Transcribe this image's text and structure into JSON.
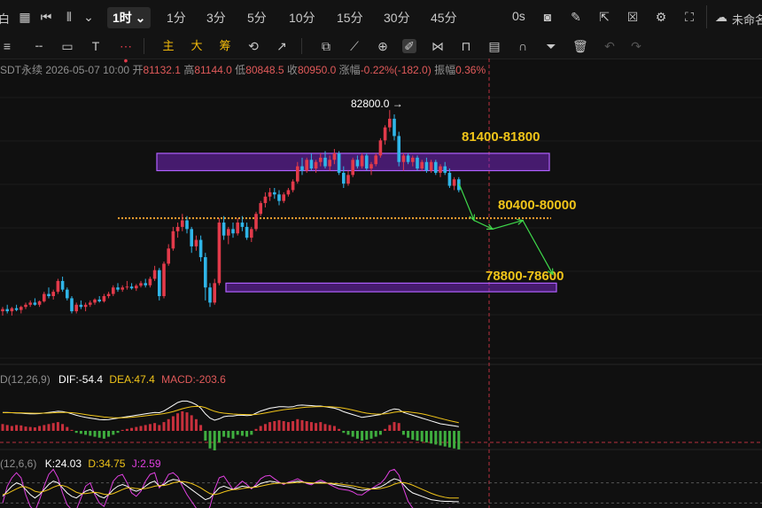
{
  "toolbar": {
    "left_label": "白",
    "intervals": [
      {
        "label": "1时",
        "active": true
      },
      {
        "label": "1分"
      },
      {
        "label": "3分"
      },
      {
        "label": "5分"
      },
      {
        "label": "10分"
      },
      {
        "label": "15分"
      },
      {
        "label": "30分"
      },
      {
        "label": "45分"
      }
    ],
    "zero_label": "0s",
    "right_label": "未命名"
  },
  "drawbar": {
    "cn_tools": [
      "主",
      "大",
      "筹"
    ]
  },
  "info": {
    "symbol": "SDT永续",
    "datetime": "2026-05-07 10:00",
    "open_label": "开",
    "open": "81132.1",
    "high_label": "高",
    "high": "81144.0",
    "low_label": "低",
    "low": "80848.5",
    "close_label": "收",
    "close": "80950.0",
    "change_label": "涨幅",
    "change": "-0.22%(-182.0)",
    "amp_label": "振幅",
    "amp": "0.36%"
  },
  "macd": {
    "name": "D(12,26,9)",
    "dif": "DIF:-54.4",
    "dea": "DEA:47.4",
    "macd": "MACD:-203.6"
  },
  "kdj": {
    "name": "(12,6,6)",
    "k": "K:24.03",
    "d": "D:34.75",
    "j": "J:2.59"
  },
  "chart_data": {
    "type": "candlestick",
    "ylim": [
      77250,
      83500
    ],
    "peak_label": "82800.0 →",
    "zones": [
      {
        "label": "81400-81800",
        "low": 81400,
        "high": 81800,
        "color": "#8a2be2"
      },
      {
        "label": "78800-78600",
        "low": 78600,
        "high": 78800,
        "color": "#8a2be2"
      }
    ],
    "dotted_level": {
      "label": "80400-80000",
      "value": 80300,
      "color": "#f0a030"
    },
    "forecast_path": [
      81100,
      80250,
      80050,
      80250,
      79000
    ],
    "colors": {
      "up": "#e23a4a",
      "down": "#2fb5e8",
      "label": "#f0c419"
    },
    "candles": [
      [
        78150,
        78250,
        78050,
        78200
      ],
      [
        78200,
        78300,
        78100,
        78150
      ],
      [
        78150,
        78250,
        78050,
        78220
      ],
      [
        78220,
        78300,
        78150,
        78180
      ],
      [
        78180,
        78280,
        78100,
        78250
      ],
      [
        78250,
        78350,
        78200,
        78300
      ],
      [
        78300,
        78400,
        78250,
        78350
      ],
      [
        78350,
        78450,
        78280,
        78300
      ],
      [
        78300,
        78400,
        78250,
        78380
      ],
      [
        78380,
        78600,
        78350,
        78550
      ],
      [
        78550,
        78700,
        78450,
        78500
      ],
      [
        78500,
        78650,
        78420,
        78600
      ],
      [
        78600,
        78900,
        78550,
        78850
      ],
      [
        78850,
        78950,
        78600,
        78650
      ],
      [
        78650,
        78700,
        78400,
        78450
      ],
      [
        78450,
        78500,
        78100,
        78150
      ],
      [
        78150,
        78350,
        78100,
        78300
      ],
      [
        78300,
        78400,
        78200,
        78250
      ],
      [
        78250,
        78350,
        78150,
        78300
      ],
      [
        78300,
        78400,
        78250,
        78350
      ],
      [
        78350,
        78450,
        78300,
        78420
      ],
      [
        78420,
        78500,
        78350,
        78380
      ],
      [
        78380,
        78550,
        78350,
        78500
      ],
      [
        78500,
        78600,
        78450,
        78550
      ],
      [
        78550,
        78750,
        78500,
        78700
      ],
      [
        78700,
        78800,
        78600,
        78650
      ],
      [
        78650,
        78750,
        78600,
        78700
      ],
      [
        78700,
        78850,
        78650,
        78720
      ],
      [
        78720,
        78800,
        78650,
        78680
      ],
      [
        78680,
        78780,
        78620,
        78740
      ],
      [
        78740,
        78850,
        78700,
        78800
      ],
      [
        78800,
        78900,
        78700,
        78750
      ],
      [
        78750,
        78950,
        78700,
        78900
      ],
      [
        78900,
        79200,
        78850,
        79100
      ],
      [
        79100,
        79150,
        78400,
        78500
      ],
      [
        78500,
        79300,
        78450,
        79250
      ],
      [
        79250,
        79700,
        79200,
        79600
      ],
      [
        79600,
        80100,
        79550,
        80000
      ],
      [
        80000,
        80200,
        79850,
        80100
      ],
      [
        80100,
        80400,
        80000,
        80250
      ],
      [
        80250,
        80350,
        79950,
        80050
      ],
      [
        80050,
        80100,
        79500,
        79650
      ],
      [
        79650,
        79900,
        79550,
        79800
      ],
      [
        79800,
        79900,
        79300,
        79400
      ],
      [
        79400,
        79500,
        78400,
        78700
      ],
      [
        78700,
        78800,
        78250,
        78350
      ],
      [
        78350,
        78900,
        78300,
        78800
      ],
      [
        78800,
        80300,
        78750,
        80200
      ],
      [
        80200,
        80350,
        79800,
        79900
      ],
      [
        79900,
        80100,
        79700,
        80050
      ],
      [
        80050,
        80200,
        79850,
        79950
      ],
      [
        79950,
        80300,
        79900,
        80200
      ],
      [
        80200,
        80350,
        80000,
        80100
      ],
      [
        80100,
        80200,
        79800,
        79850
      ],
      [
        79850,
        80100,
        79750,
        80050
      ],
      [
        80050,
        80450,
        80000,
        80400
      ],
      [
        80400,
        80700,
        80350,
        80650
      ],
      [
        80650,
        80900,
        80550,
        80800
      ],
      [
        80800,
        81000,
        80700,
        80900
      ],
      [
        80900,
        81000,
        80750,
        80850
      ],
      [
        80850,
        80950,
        80600,
        80700
      ],
      [
        80700,
        80900,
        80650,
        80850
      ],
      [
        80850,
        81000,
        80800,
        80950
      ],
      [
        80950,
        81200,
        80900,
        81150
      ],
      [
        81150,
        81600,
        81100,
        81500
      ],
      [
        81500,
        81700,
        81300,
        81400
      ],
      [
        81400,
        81700,
        81350,
        81650
      ],
      [
        81650,
        81800,
        81400,
        81450
      ],
      [
        81450,
        81650,
        81350,
        81600
      ],
      [
        81600,
        81800,
        81500,
        81700
      ],
      [
        81700,
        81850,
        81450,
        81500
      ],
      [
        81500,
        81750,
        81400,
        81650
      ],
      [
        81650,
        81900,
        81550,
        81800
      ],
      [
        81800,
        81850,
        81300,
        81350
      ],
      [
        81350,
        81500,
        81000,
        81100
      ],
      [
        81100,
        81400,
        81050,
        81300
      ],
      [
        81300,
        81700,
        81250,
        81650
      ],
      [
        81650,
        81750,
        81450,
        81500
      ],
      [
        81500,
        81800,
        81450,
        81750
      ],
      [
        81750,
        81800,
        81400,
        81450
      ],
      [
        81450,
        81600,
        81300,
        81550
      ],
      [
        81550,
        81800,
        81500,
        81750
      ],
      [
        81750,
        82150,
        81700,
        82100
      ],
      [
        82100,
        82450,
        82000,
        82400
      ],
      [
        82400,
        82800,
        82300,
        82600
      ],
      [
        82600,
        82700,
        82100,
        82200
      ],
      [
        82200,
        82300,
        81500,
        81600
      ],
      [
        81600,
        81800,
        81400,
        81750
      ],
      [
        81750,
        81800,
        81550,
        81600
      ],
      [
        81600,
        81750,
        81500,
        81700
      ],
      [
        81700,
        81750,
        81400,
        81450
      ],
      [
        81450,
        81650,
        81400,
        81600
      ],
      [
        81600,
        81700,
        81350,
        81400
      ],
      [
        81400,
        81650,
        81350,
        81600
      ],
      [
        81600,
        81650,
        81300,
        81350
      ],
      [
        81350,
        81550,
        81250,
        81500
      ],
      [
        81500,
        81600,
        81300,
        81350
      ],
      [
        81350,
        81450,
        81000,
        81050
      ],
      [
        81050,
        81250,
        80950,
        81200
      ],
      [
        81200,
        81250,
        80900,
        80950
      ]
    ],
    "macd_hist": [
      0.35,
      0.3,
      0.25,
      0.3,
      0.28,
      0.22,
      0.2,
      0.18,
      0.25,
      0.3,
      0.35,
      0.4,
      0.45,
      0.35,
      0.2,
      0.05,
      -0.1,
      -0.15,
      -0.2,
      -0.25,
      -0.3,
      -0.35,
      -0.4,
      -0.3,
      -0.2,
      -0.1,
      0.05,
      0.1,
      0.15,
      0.2,
      0.25,
      0.3,
      0.35,
      0.4,
      0.3,
      0.45,
      0.6,
      0.75,
      0.9,
      1.0,
      0.95,
      0.8,
      0.6,
      0.3,
      -0.5,
      -0.9,
      -1.0,
      -0.6,
      -0.3,
      -0.35,
      -0.4,
      -0.2,
      -0.25,
      -0.3,
      -0.2,
      0.1,
      0.25,
      0.35,
      0.45,
      0.5,
      0.55,
      0.5,
      0.45,
      0.5,
      0.6,
      0.55,
      0.5,
      0.45,
      0.4,
      0.45,
      0.35,
      0.3,
      0.25,
      0.1,
      -0.1,
      -0.2,
      -0.3,
      -0.4,
      -0.5,
      -0.45,
      -0.4,
      -0.3,
      -0.2,
      0.1,
      0.3,
      0.45,
      0.4,
      -0.2,
      -0.35,
      -0.45,
      -0.5,
      -0.55,
      -0.6,
      -0.65,
      -0.7,
      -0.75,
      -0.8,
      -0.85,
      -0.9,
      -0.95
    ],
    "dif": [
      0.3,
      0.3,
      0.28,
      0.26,
      0.25,
      0.22,
      0.2,
      0.2,
      0.22,
      0.26,
      0.3,
      0.34,
      0.38,
      0.36,
      0.3,
      0.2,
      0.1,
      0.02,
      -0.05,
      -0.1,
      -0.15,
      -0.2,
      -0.22,
      -0.2,
      -0.15,
      -0.1,
      -0.05,
      0.0,
      0.05,
      0.1,
      0.15,
      0.2,
      0.25,
      0.3,
      0.28,
      0.4,
      0.6,
      0.8,
      1.0,
      1.1,
      1.1,
      1.0,
      0.85,
      0.6,
      0.2,
      -0.1,
      -0.25,
      -0.15,
      0.0,
      0.05,
      0.05,
      0.1,
      0.1,
      0.08,
      0.1,
      0.25,
      0.4,
      0.5,
      0.6,
      0.65,
      0.7,
      0.7,
      0.68,
      0.7,
      0.8,
      0.82,
      0.8,
      0.78,
      0.75,
      0.75,
      0.7,
      0.65,
      0.6,
      0.5,
      0.35,
      0.25,
      0.15,
      0.05,
      -0.05,
      0.0,
      0.05,
      0.1,
      0.15,
      0.3,
      0.45,
      0.55,
      0.5,
      0.3,
      0.2,
      0.1,
      0.0,
      -0.1,
      -0.2,
      -0.3,
      -0.4,
      -0.5,
      -0.55,
      -0.6,
      -0.65,
      -0.7
    ],
    "dea": [
      0.28,
      0.28,
      0.28,
      0.27,
      0.27,
      0.26,
      0.25,
      0.24,
      0.24,
      0.25,
      0.26,
      0.27,
      0.29,
      0.3,
      0.3,
      0.28,
      0.25,
      0.2,
      0.15,
      0.1,
      0.06,
      0.02,
      -0.02,
      -0.05,
      -0.07,
      -0.08,
      -0.08,
      -0.06,
      -0.04,
      -0.01,
      0.02,
      0.06,
      0.1,
      0.14,
      0.17,
      0.22,
      0.28,
      0.36,
      0.46,
      0.56,
      0.64,
      0.7,
      0.73,
      0.72,
      0.64,
      0.5,
      0.38,
      0.3,
      0.25,
      0.22,
      0.19,
      0.17,
      0.16,
      0.15,
      0.14,
      0.16,
      0.2,
      0.26,
      0.32,
      0.38,
      0.44,
      0.49,
      0.53,
      0.56,
      0.6,
      0.64,
      0.67,
      0.69,
      0.7,
      0.71,
      0.71,
      0.7,
      0.68,
      0.65,
      0.6,
      0.54,
      0.47,
      0.39,
      0.31,
      0.25,
      0.21,
      0.19,
      0.18,
      0.2,
      0.25,
      0.31,
      0.35,
      0.36,
      0.34,
      0.3,
      0.26,
      0.2,
      0.13,
      0.05,
      -0.03,
      -0.12,
      -0.2,
      -0.28,
      -0.35,
      -0.42
    ],
    "kdj_k": [
      40,
      55,
      70,
      80,
      75,
      60,
      45,
      35,
      45,
      60,
      75,
      85,
      80,
      65,
      50,
      40,
      35,
      45,
      55,
      60,
      50,
      40,
      35,
      45,
      60,
      70,
      75,
      70,
      60,
      55,
      60,
      70,
      80,
      85,
      70,
      75,
      85,
      90,
      88,
      80,
      70,
      60,
      50,
      40,
      30,
      35,
      50,
      65,
      70,
      65,
      60,
      65,
      70,
      68,
      65,
      70,
      78,
      82,
      85,
      83,
      80,
      78,
      80,
      82,
      85,
      83,
      80,
      78,
      80,
      82,
      80,
      78,
      75,
      72,
      70,
      68,
      65,
      60,
      58,
      60,
      62,
      65,
      68,
      75,
      85,
      92,
      88,
      75,
      60,
      50,
      45,
      40,
      35,
      30,
      28,
      26,
      25,
      25,
      24,
      24
    ],
    "kdj_d": [
      45,
      48,
      55,
      62,
      68,
      68,
      63,
      55,
      52,
      55,
      60,
      67,
      72,
      72,
      68,
      60,
      52,
      48,
      48,
      50,
      52,
      50,
      46,
      45,
      48,
      54,
      60,
      65,
      65,
      63,
      62,
      63,
      66,
      70,
      72,
      72,
      75,
      80,
      83,
      84,
      82,
      78,
      72,
      65,
      56,
      48,
      45,
      48,
      53,
      57,
      60,
      61,
      63,
      65,
      66,
      67,
      70,
      73,
      76,
      78,
      79,
      79,
      79,
      80,
      81,
      82,
      81,
      80,
      79,
      79,
      79,
      79,
      78,
      77,
      75,
      73,
      71,
      68,
      65,
      63,
      62,
      62,
      63,
      66,
      70,
      76,
      80,
      81,
      78,
      73,
      67,
      61,
      55,
      49,
      44,
      40,
      37,
      35,
      35,
      35
    ],
    "kdj_j": [
      20,
      70,
      95,
      110,
      95,
      45,
      10,
      -5,
      30,
      70,
      105,
      120,
      95,
      50,
      15,
      0,
      0,
      35,
      70,
      80,
      45,
      20,
      10,
      45,
      85,
      100,
      105,
      80,
      50,
      40,
      55,
      85,
      105,
      110,
      65,
      80,
      105,
      110,
      98,
      70,
      45,
      25,
      5,
      -10,
      -20,
      10,
      60,
      95,
      100,
      80,
      60,
      72,
      85,
      75,
      62,
      75,
      92,
      100,
      102,
      92,
      82,
      75,
      82,
      86,
      92,
      85,
      78,
      74,
      82,
      88,
      82,
      75,
      68,
      62,
      60,
      58,
      53,
      45,
      44,
      54,
      62,
      71,
      78,
      93,
      115,
      120,
      103,
      63,
      25,
      5,
      0,
      -2,
      -5,
      -8,
      -4,
      -2,
      1,
      5,
      2,
      2.59
    ]
  }
}
